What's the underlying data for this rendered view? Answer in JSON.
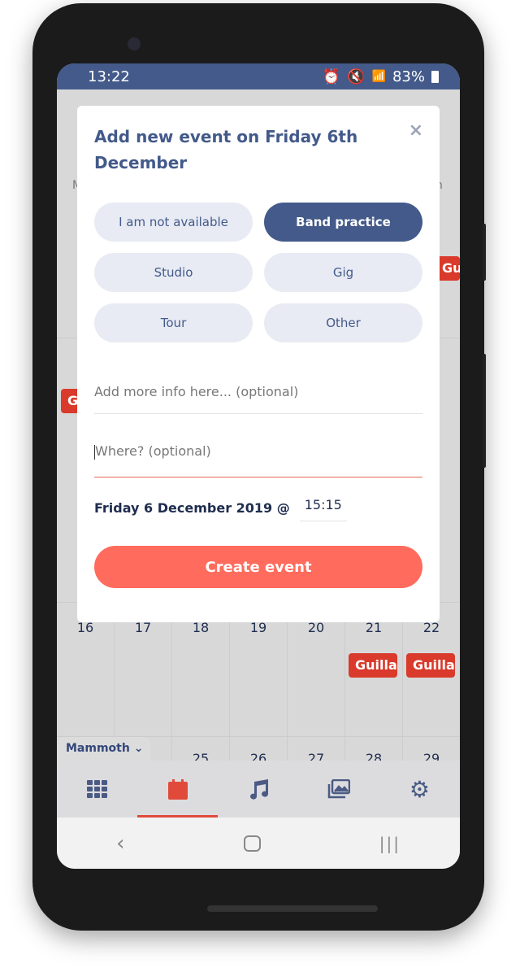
{
  "status_bar": {
    "time": "13:22",
    "battery": "83%",
    "icons": [
      "alarm-icon",
      "mute-icon",
      "wifi-icon",
      "signal-icon",
      "battery-icon"
    ]
  },
  "calendar": {
    "weekday_fragments": {
      "left": "M",
      "right": "n"
    },
    "week3": [
      "16",
      "17",
      "18",
      "19",
      "20",
      "21",
      "22"
    ],
    "week4": [
      "25",
      "26",
      "27",
      "28",
      "29"
    ],
    "events": [
      {
        "label": "Guillau"
      },
      {
        "label": "G"
      },
      {
        "label": "Guillau"
      },
      {
        "label": "Guillau"
      }
    ],
    "band_selector": "Mammoth"
  },
  "modal": {
    "title": "Add new event on Friday 6th December",
    "close": "×",
    "types": [
      {
        "label": "I am not available",
        "selected": false
      },
      {
        "label": "Band practice",
        "selected": true
      },
      {
        "label": "Studio",
        "selected": false
      },
      {
        "label": "Gig",
        "selected": false
      },
      {
        "label": "Tour",
        "selected": false
      },
      {
        "label": "Other",
        "selected": false
      }
    ],
    "info_placeholder": "Add more info here... (optional)",
    "where_placeholder": "Where? (optional)",
    "date_label": "Friday 6 December 2019 @",
    "time": "15:15",
    "create_label": "Create event"
  },
  "bottom_nav": [
    {
      "icon": "grid-icon"
    },
    {
      "icon": "calendar-icon",
      "active": true
    },
    {
      "icon": "music-icon"
    },
    {
      "icon": "gallery-icon"
    },
    {
      "icon": "settings-icon"
    }
  ],
  "colors": {
    "primary": "#435a8a",
    "accent": "#ff6b5c",
    "event": "#d93a2b"
  }
}
